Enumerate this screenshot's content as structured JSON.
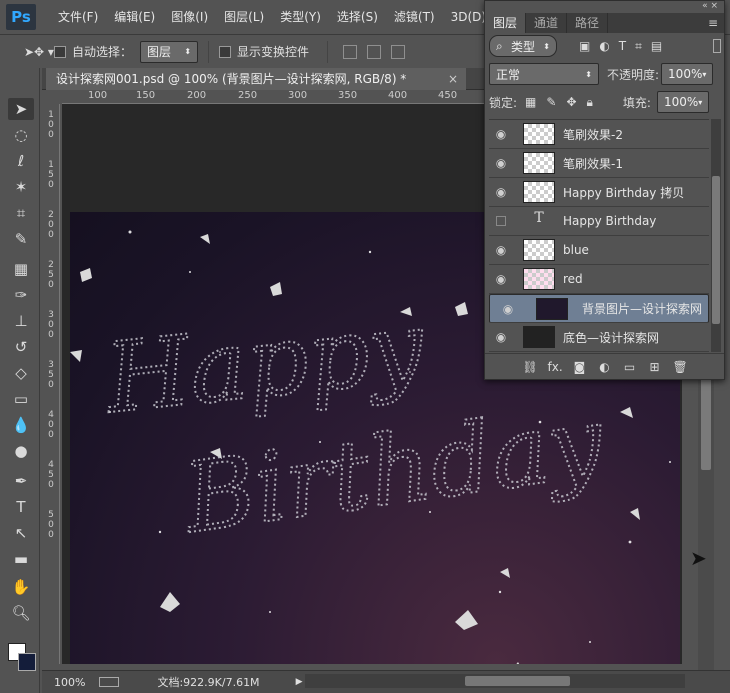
{
  "app": {
    "logo": "Ps"
  },
  "menu": [
    "文件(F)",
    "编辑(E)",
    "图像(I)",
    "图层(L)",
    "类型(Y)",
    "选择(S)",
    "滤镜(T)",
    "3D(D)"
  ],
  "options": {
    "auto_select_label": "自动选择：",
    "auto_select_value": "图层",
    "show_transform_label": "显示变换控件"
  },
  "document": {
    "tab_title": "设计探索网001.psd @ 100% (背景图片—设计探索网, RGB/8) *",
    "close": "×"
  },
  "ruler_h": [
    "100",
    "150",
    "200",
    "250",
    "300",
    "350",
    "400",
    "450"
  ],
  "ruler_v": [
    "1",
    "0",
    "0",
    "1",
    "5",
    "0",
    "2",
    "0",
    "0",
    "2",
    "5",
    "0",
    "3",
    "0",
    "0",
    "3",
    "5",
    "0",
    "4",
    "0",
    "0",
    "4",
    "5",
    "0",
    "5",
    "0",
    "0"
  ],
  "canvas_text": {
    "line1": "Happy",
    "line2": "Birthday"
  },
  "status": {
    "zoom": "100%",
    "doc_info": "文档:922.9K/7.61M"
  },
  "layers_panel": {
    "tabs": [
      "图层",
      "通道",
      "路径"
    ],
    "filter_type": "类型",
    "blend_mode": "正常",
    "opacity_label": "不透明度:",
    "opacity_value": "100%",
    "lock_label": "锁定:",
    "fill_label": "填充:",
    "fill_value": "100%",
    "layers": [
      {
        "name": "笔刷效果-2",
        "visible": true,
        "thumb": "transparent"
      },
      {
        "name": "笔刷效果-1",
        "visible": true,
        "thumb": "transparent"
      },
      {
        "name": "Happy   Birthday 拷贝",
        "visible": true,
        "thumb": "transparent"
      },
      {
        "name": "Happy   Birthday",
        "visible": false,
        "thumb": "text"
      },
      {
        "name": "blue",
        "visible": true,
        "thumb": "transparent"
      },
      {
        "name": "red",
        "visible": true,
        "thumb": "transparent"
      },
      {
        "name": "背景图片—设计探索网",
        "visible": true,
        "thumb": "photo",
        "selected": true
      },
      {
        "name": "底色—设计探索网",
        "visible": true,
        "thumb": "dark"
      }
    ],
    "text_thumb_glyph": "T",
    "bottom_icons": [
      "link-icon",
      "fx-icon",
      "mask-icon",
      "adjustment-icon",
      "group-icon",
      "new-layer-icon",
      "delete-icon"
    ],
    "fx_label": "fx."
  },
  "colors": {
    "accent": "#31a8ff",
    "selected_layer": "#6f7f94",
    "panel_bg": "#535353"
  }
}
